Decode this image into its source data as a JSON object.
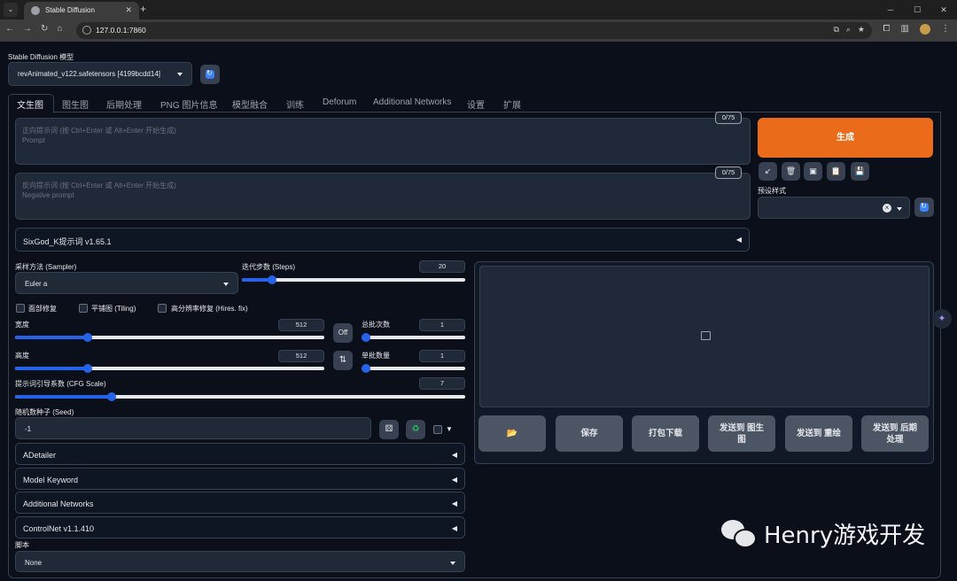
{
  "browser": {
    "tab_title": "Stable Diffusion",
    "url": "127.0.0.1:7860",
    "tab_close": "✕",
    "new_tab": "+",
    "win_min": "─",
    "win_max": "☐",
    "win_close": "✕"
  },
  "model": {
    "label": "Stable Diffusion 模型",
    "value": "revAnimated_v122.safetensors [4199bcdd14]"
  },
  "tabs": [
    "文生图",
    "图生图",
    "后期处理",
    "PNG 图片信息",
    "模型融合",
    "训练",
    "Deforum",
    "Additional Networks",
    "设置",
    "扩展"
  ],
  "prompt": {
    "placeholder_line1": "正向提示词 (按 Ctrl+Enter 或 Alt+Enter 开始生成)",
    "placeholder_line2": "Prompt",
    "counter": "0/75"
  },
  "negative_prompt": {
    "placeholder_line1": "反向提示词 (按 Ctrl+Enter 或 Alt+Enter 开始生成)",
    "placeholder_line2": "Negative prompt",
    "counter": "0/75"
  },
  "generate_label": "生成",
  "tools": [
    "↙",
    "🗑",
    "▣",
    "📋",
    "💾"
  ],
  "preset": {
    "label": "预设样式",
    "clear": "×"
  },
  "sixgod_label": "SixGod_K提示词 v1.65.1",
  "sampler": {
    "label": "采样方法 (Sampler)",
    "value": "Euler a"
  },
  "steps": {
    "label": "迭代步数 (Steps)",
    "value": "20",
    "fraction": 0.136
  },
  "checkboxes": {
    "face": "面部修复",
    "tiling": "平铺图 (Tiling)",
    "hires": "高分辨率修复 (Hires. fix)"
  },
  "width": {
    "label": "宽度",
    "value": "512",
    "fraction": 0.234
  },
  "height": {
    "label": "高度",
    "value": "512",
    "fraction": 0.234
  },
  "off_label": "Off",
  "swap_label": "⇅",
  "batch_count": {
    "label": "总批次数",
    "value": "1",
    "fraction": 0.0
  },
  "batch_size": {
    "label": "单批数量",
    "value": "1",
    "fraction": 0.0
  },
  "cfg": {
    "label": "提示词引导系数 (CFG Scale)",
    "value": "7",
    "fraction": 0.214
  },
  "seed": {
    "label": "随机数种子 (Seed)",
    "value": "-1",
    "extra_arrow": "▼"
  },
  "accordions": [
    "ADetailer",
    "Model Keyword",
    "Additional Networks",
    "ControlNet v1.1.410"
  ],
  "script": {
    "label": "脚本",
    "value": "None"
  },
  "output_buttons": [
    "📂",
    "保存",
    "打包下载",
    "发送到 图生图",
    "发送到 重绘",
    "发送到 后期处理"
  ],
  "watermark": "Henry游戏开发",
  "colors": {
    "generate": "#ea6c1b",
    "accent": "#2563eb",
    "bg": "#0b0f19"
  }
}
